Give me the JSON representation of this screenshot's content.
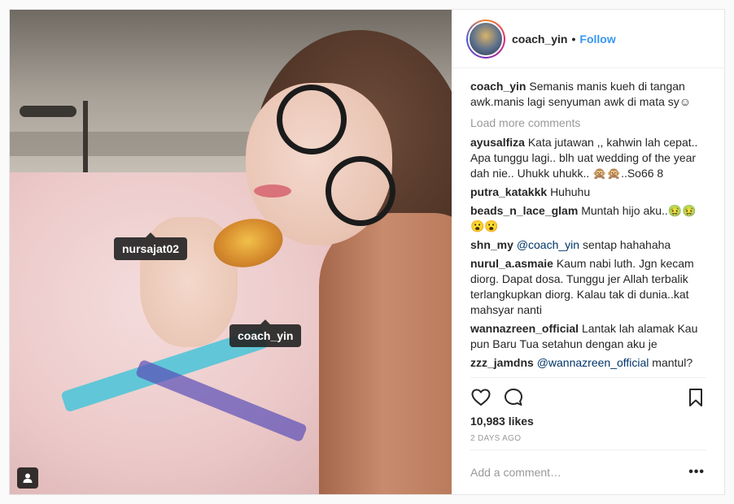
{
  "post": {
    "username": "coach_yin",
    "follow_label": "Follow",
    "dot": "•"
  },
  "photo_tags": [
    {
      "label": "nursajat02"
    },
    {
      "label": "coach_yin"
    }
  ],
  "caption": {
    "username": "coach_yin",
    "text": "Semanis manis kueh di tangan awk.manis lagi senyuman awk di mata sy☺"
  },
  "load_more": "Load more comments",
  "comments": [
    {
      "username": "ayusalfiza",
      "text": "Kata jutawan ,, kahwin lah cepat.. Apa tunggu lagi.. blh uat wedding of the year dah nie.. Uhukk uhukk.. 🙊🙊..So66 8"
    },
    {
      "username": "putra_katakkk",
      "text": "Huhuhu"
    },
    {
      "username": "beads_n_lace_glam",
      "text": "Muntah hijo aku..🤢🤢😮😮"
    },
    {
      "username": "shn_my",
      "mention": "@coach_yin",
      "text": " sentap hahahaha"
    },
    {
      "username": "nurul_a.asmaie",
      "text": "Kaum nabi luth. Jgn kecam diorg. Dapat dosa. Tunggu jer Allah terbalik terlangkupkan diorg. Kalau tak di dunia..kat mahsyar nanti"
    },
    {
      "username": "wannazreen_official",
      "text": "Lantak lah alamak Kau pun Baru Tua setahun dengan aku je"
    },
    {
      "username": "zzz_jamdns",
      "mention": "@wannazreen_official",
      "text": " mantul?"
    }
  ],
  "likes": "10,983 likes",
  "time_ago": "2 DAYS AGO",
  "add_comment_placeholder": "Add a comment…",
  "more_label": "•••",
  "icons": [
    "heart-icon",
    "comment-icon",
    "bookmark-icon",
    "user-tag-icon"
  ]
}
